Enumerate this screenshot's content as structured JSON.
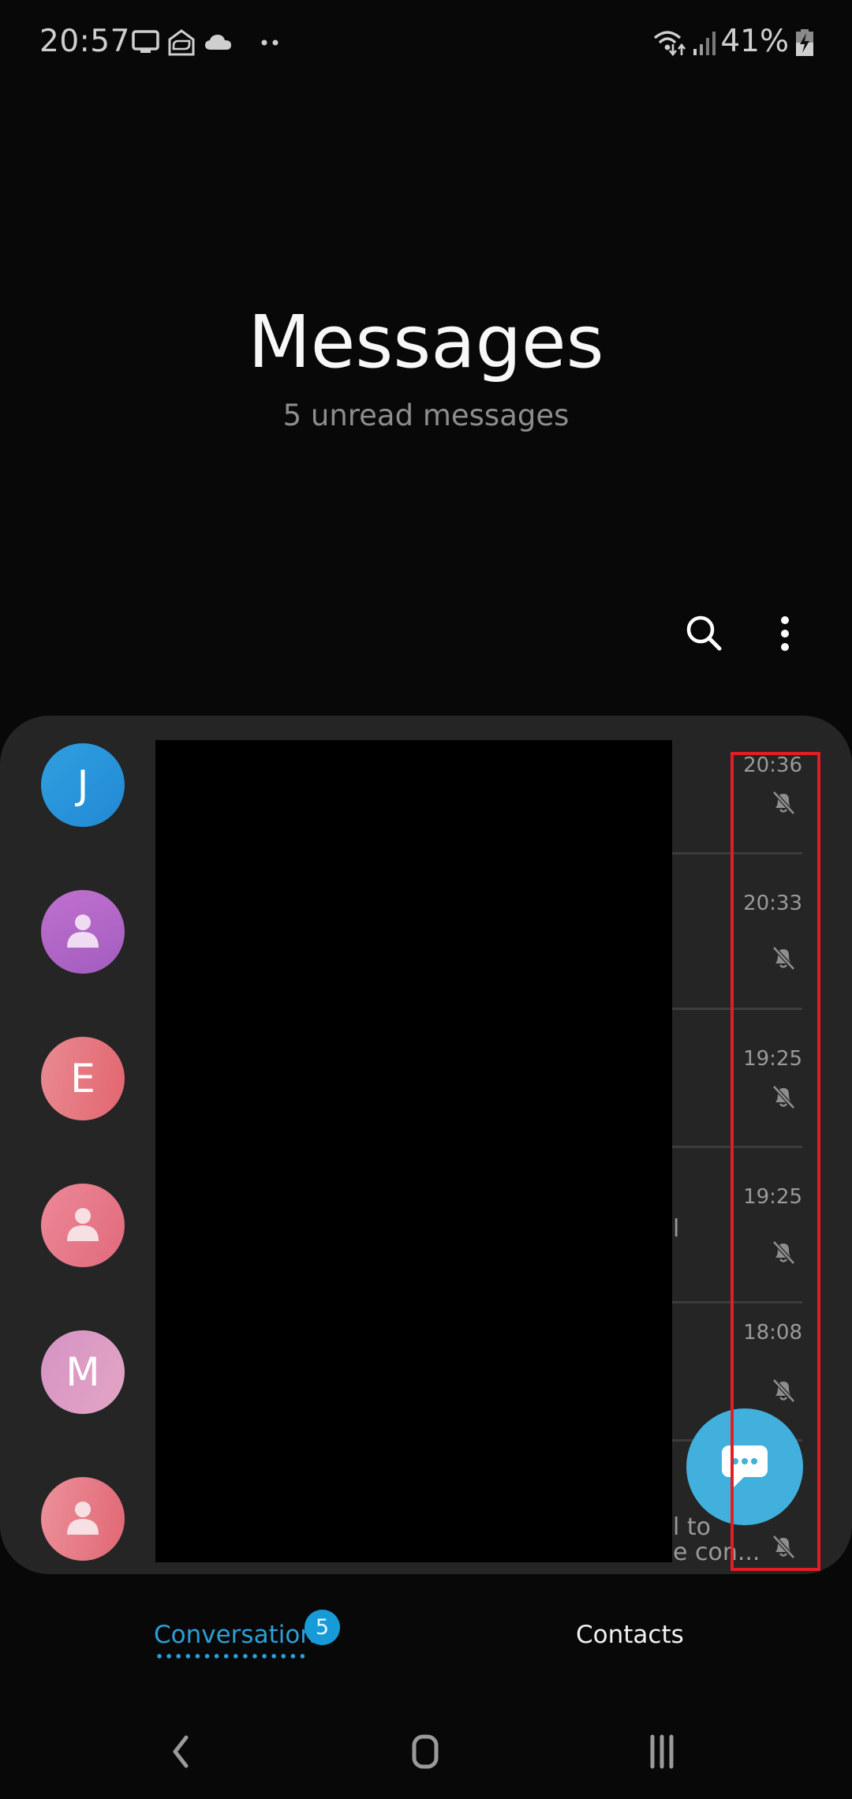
{
  "status_bar": {
    "time": "20:57",
    "left_icons": [
      "screen-mirror-icon",
      "email-open-icon",
      "cloud-icon",
      "more-notifications-icon"
    ],
    "right_icons": [
      "wifi-data-icon",
      "signal-icon",
      "battery-charging-icon"
    ],
    "battery": "41%"
  },
  "header": {
    "title": "Messages",
    "subtitle": "5 unread messages",
    "actions": [
      "search-icon",
      "more-options-icon"
    ]
  },
  "conversations": [
    {
      "avatar_type": "initial",
      "initial": "J",
      "color": "#2b95dc",
      "time": "20:36",
      "muted": true,
      "snippet": ""
    },
    {
      "avatar_type": "person",
      "initial": "",
      "color": "#b065c9",
      "time": "20:33",
      "muted": true,
      "snippet": ""
    },
    {
      "avatar_type": "initial",
      "initial": "E",
      "color": "#e36a76",
      "time": "19:25",
      "muted": true,
      "snippet": ""
    },
    {
      "avatar_type": "person",
      "initial": "",
      "color": "#e46d7e",
      "time": "19:25",
      "muted": true,
      "snippet": "l"
    },
    {
      "avatar_type": "initial",
      "initial": "M",
      "color": "#dc9ec8",
      "time": "18:08",
      "muted": true,
      "snippet": ""
    },
    {
      "avatar_type": "person",
      "initial": "",
      "color": "#e36a76",
      "time": "",
      "muted": true,
      "snippet_line1": "l to",
      "snippet_line2": "e con..."
    }
  ],
  "fab": {
    "icon": "new-message-icon",
    "color": "#41b0dd"
  },
  "tabs": [
    {
      "label": "Conversations",
      "badge": "5",
      "active": true,
      "color": "#2c9fd6"
    },
    {
      "label": "Contacts",
      "active": false
    }
  ],
  "nav_bar": [
    "back-icon",
    "home-icon",
    "recents-icon"
  ],
  "highlight_color": "#e21d27"
}
